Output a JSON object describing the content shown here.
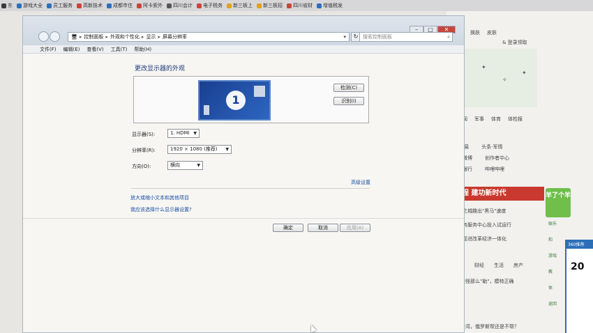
{
  "favorites": [
    {
      "label": "东",
      "color": "#3a3a3a"
    },
    {
      "label": "游戏大全",
      "color": "#2c6fb8"
    },
    {
      "label": "员工服务",
      "color": "#2c6fb8"
    },
    {
      "label": "高新技术",
      "color": "#c6463a"
    },
    {
      "label": "成都市住",
      "color": "#2c6fb8"
    },
    {
      "label": "阿卡索外",
      "color": "#c6463a"
    },
    {
      "label": "四川会计",
      "color": "#555555"
    },
    {
      "label": "电子税务",
      "color": "#c6463a"
    },
    {
      "label": "新三板上",
      "color": "#e0a020"
    },
    {
      "label": "新三板招",
      "color": "#e0a020"
    },
    {
      "label": "四川省财",
      "color": "#c6463a"
    },
    {
      "label": "增值税发",
      "color": "#2c6fb8"
    }
  ],
  "window": {
    "breadcrumb": [
      "控制面板",
      "外观和个性化",
      "显示",
      "屏幕分辨率"
    ],
    "search_placeholder": "搜索控制面板",
    "menus": [
      "文件(F)",
      "编辑(E)",
      "查看(V)",
      "工具(T)",
      "帮助(H)"
    ],
    "controls": {
      "minimize": "–",
      "maximize": "□",
      "close": "✕"
    }
  },
  "page": {
    "title": "更改显示器的外观",
    "monitor_number": "1",
    "detect_label": "检测(C)",
    "identify_label": "识别(I)",
    "display_label": "显示器(S):",
    "display_value": "1. HDMI",
    "resolution_label": "分辨率(R):",
    "resolution_value": "1920 × 1080 (推荐)",
    "orientation_label": "方向(O):",
    "orientation_value": "横向",
    "advanced_link": "高级设置",
    "link_text_size": "放大或缩小文本和其他项目",
    "link_which_settings": "我应该选择什么显示器设置?",
    "ok_label": "确定",
    "cancel_label": "取消",
    "apply_label": "应用(A)"
  },
  "background_page": {
    "topnav": [
      "设置",
      "换肤",
      "皮肤"
    ],
    "account": "& 登录领取",
    "channels": [
      "新闻",
      "军事",
      "体育",
      "体检报"
    ],
    "links1": [
      "网 易",
      "头条·军情"
    ],
    "links2": [
      "浪微博",
      "创作者中心"
    ],
    "links3": [
      "商银行",
      "哔哩哔哩"
    ],
    "banner": "程  建功新时代",
    "news": [
      "创之城趣出\"黑马\"速度",
      "政务服务中心投入试运行",
      "力促进改革经济一体化"
    ],
    "tabs": [
      "财经",
      "生活",
      "房产"
    ],
    "headline1": "难怪那么\"勒\"，模特正确",
    "headline2": "台湾，俄罗斯帮还是不帮？",
    "mascot": "羊了个羊",
    "side": [
      "娱乐",
      "和",
      "游戏",
      "教",
      "体",
      "返回"
    ],
    "popup_header": "360推荐",
    "popup_value": "20"
  }
}
